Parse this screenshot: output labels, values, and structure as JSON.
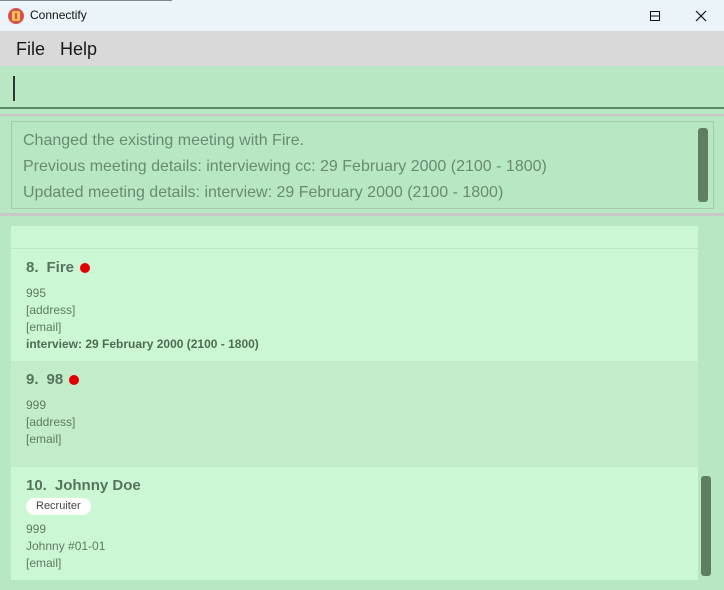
{
  "window": {
    "title": "Connectify",
    "icons": {
      "app": "app-logo-icon",
      "minimize": "minimize-icon",
      "maximize": "maximize-icon",
      "close": "close-icon"
    }
  },
  "menu": {
    "file": "File",
    "help": "Help"
  },
  "command": {
    "value": ""
  },
  "result": {
    "lines": [
      "Changed the existing meeting with Fire.",
      "Previous meeting details: interviewing cc: 29 February 2000 (2100 - 1800)",
      "Updated meeting details: interview: 29 February 2000 (2100 - 1800)"
    ]
  },
  "persons": [
    {
      "index": "8.",
      "name": "Fire",
      "flagged": true,
      "phone": "995",
      "address": "[address]",
      "email": "[email]",
      "meeting": "interview: 29 February 2000 (2100 - 1800)"
    },
    {
      "index": "9.",
      "name": "98",
      "flagged": true,
      "phone": "999",
      "address": "[address]",
      "email": "[email]"
    },
    {
      "index": "10.",
      "name": "Johnny Doe",
      "flagged": false,
      "tag": "Recruiter",
      "phone": "999",
      "address": "Johnny #01-01",
      "email": "[email]"
    }
  ],
  "colors": {
    "flag": "#e00000",
    "background": "#b7e8c3",
    "card": "#ccf7d5"
  }
}
